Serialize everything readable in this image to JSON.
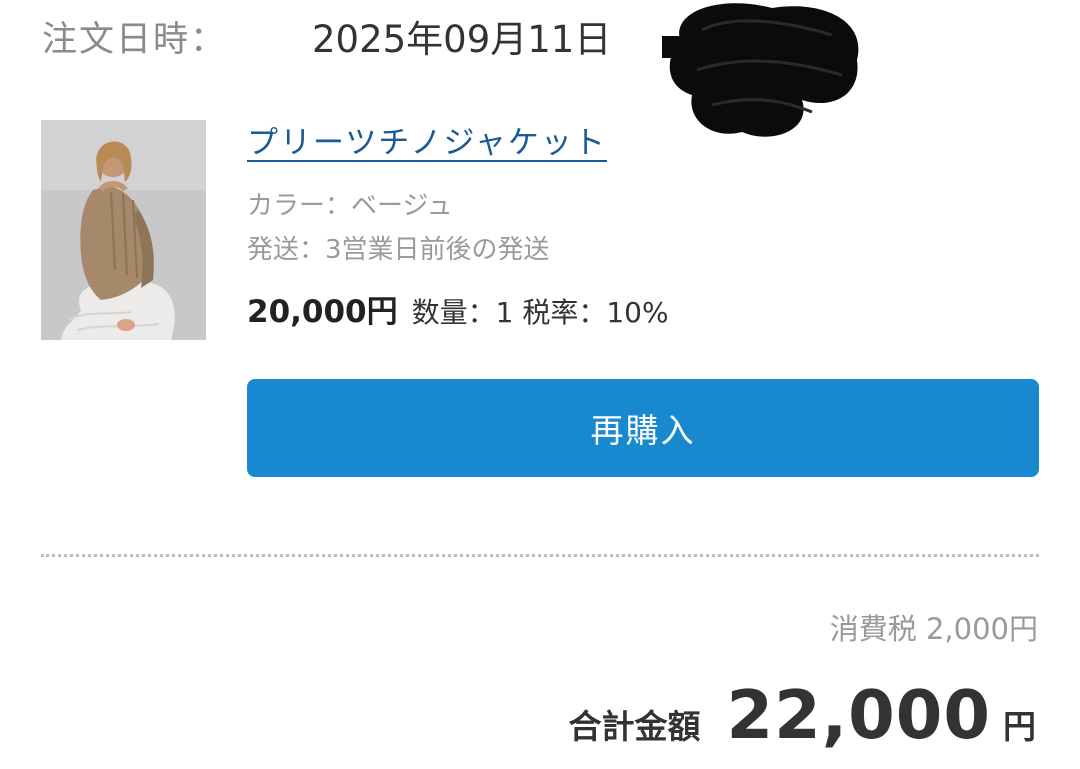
{
  "order": {
    "date_label": "注文日時：",
    "date_value": "2025年09月11日"
  },
  "product": {
    "name": "プリーツチノジャケット",
    "color": "カラー：ベージュ",
    "shipping": "発送：3営業日前後の発送",
    "price": "20,000円",
    "quantity_tax": "数量：1 税率：10%"
  },
  "actions": {
    "rebuy_label": "再購入",
    "button_color": "#1889cf"
  },
  "summary": {
    "consumption_tax": "消費税 2,000円",
    "total_label": "合計金額",
    "total_value": "22,000",
    "total_unit": "円"
  },
  "colors": {
    "link": "#1a5a96",
    "muted_text": "#9a9a9a",
    "body_text": "#333333"
  }
}
